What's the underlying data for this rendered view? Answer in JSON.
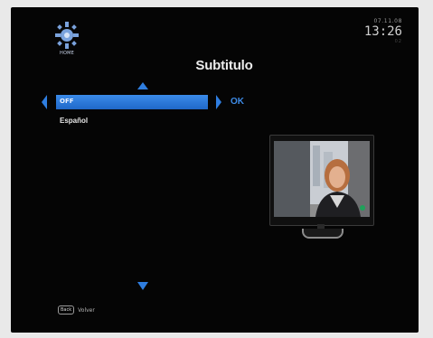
{
  "header": {
    "logo_text": "HOME",
    "date": "07.11.08",
    "time": "13:26",
    "seconds": "02"
  },
  "menu": {
    "title": "Subtitulo",
    "options": [
      "OFF",
      "Español"
    ],
    "selected_index": 0,
    "confirm_label": "OK"
  },
  "footer": {
    "back_key": "Back",
    "back_label": "Volver"
  },
  "icons": [
    "globe-logo-icon",
    "arrow-up-icon",
    "arrow-down-icon",
    "arrow-left-icon",
    "arrow-right-icon",
    "tv-preview-icon"
  ],
  "colors": {
    "accent": "#2f7ee0",
    "background": "#050505"
  }
}
